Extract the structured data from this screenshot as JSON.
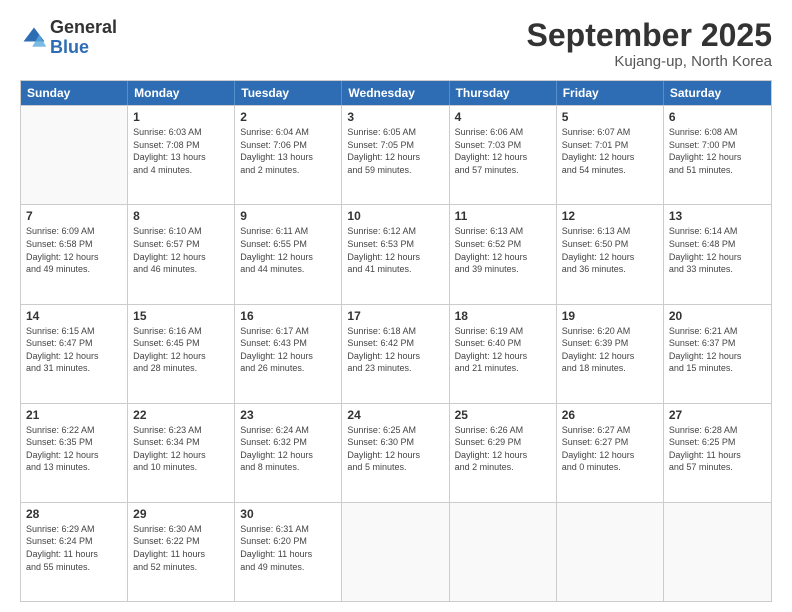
{
  "logo": {
    "general": "General",
    "blue": "Blue"
  },
  "title": "September 2025",
  "location": "Kujang-up, North Korea",
  "days_of_week": [
    "Sunday",
    "Monday",
    "Tuesday",
    "Wednesday",
    "Thursday",
    "Friday",
    "Saturday"
  ],
  "weeks": [
    [
      {
        "day": "",
        "sunrise": "",
        "sunset": "",
        "daylight": "",
        "empty": true
      },
      {
        "day": "1",
        "sunrise": "Sunrise: 6:03 AM",
        "sunset": "Sunset: 7:08 PM",
        "daylight": "Daylight: 13 hours and 4 minutes.",
        "empty": false
      },
      {
        "day": "2",
        "sunrise": "Sunrise: 6:04 AM",
        "sunset": "Sunset: 7:06 PM",
        "daylight": "Daylight: 13 hours and 2 minutes.",
        "empty": false
      },
      {
        "day": "3",
        "sunrise": "Sunrise: 6:05 AM",
        "sunset": "Sunset: 7:05 PM",
        "daylight": "Daylight: 12 hours and 59 minutes.",
        "empty": false
      },
      {
        "day": "4",
        "sunrise": "Sunrise: 6:06 AM",
        "sunset": "Sunset: 7:03 PM",
        "daylight": "Daylight: 12 hours and 57 minutes.",
        "empty": false
      },
      {
        "day": "5",
        "sunrise": "Sunrise: 6:07 AM",
        "sunset": "Sunset: 7:01 PM",
        "daylight": "Daylight: 12 hours and 54 minutes.",
        "empty": false
      },
      {
        "day": "6",
        "sunrise": "Sunrise: 6:08 AM",
        "sunset": "Sunset: 7:00 PM",
        "daylight": "Daylight: 12 hours and 51 minutes.",
        "empty": false
      }
    ],
    [
      {
        "day": "7",
        "sunrise": "Sunrise: 6:09 AM",
        "sunset": "Sunset: 6:58 PM",
        "daylight": "Daylight: 12 hours and 49 minutes.",
        "empty": false
      },
      {
        "day": "8",
        "sunrise": "Sunrise: 6:10 AM",
        "sunset": "Sunset: 6:57 PM",
        "daylight": "Daylight: 12 hours and 46 minutes.",
        "empty": false
      },
      {
        "day": "9",
        "sunrise": "Sunrise: 6:11 AM",
        "sunset": "Sunset: 6:55 PM",
        "daylight": "Daylight: 12 hours and 44 minutes.",
        "empty": false
      },
      {
        "day": "10",
        "sunrise": "Sunrise: 6:12 AM",
        "sunset": "Sunset: 6:53 PM",
        "daylight": "Daylight: 12 hours and 41 minutes.",
        "empty": false
      },
      {
        "day": "11",
        "sunrise": "Sunrise: 6:13 AM",
        "sunset": "Sunset: 6:52 PM",
        "daylight": "Daylight: 12 hours and 39 minutes.",
        "empty": false
      },
      {
        "day": "12",
        "sunrise": "Sunrise: 6:13 AM",
        "sunset": "Sunset: 6:50 PM",
        "daylight": "Daylight: 12 hours and 36 minutes.",
        "empty": false
      },
      {
        "day": "13",
        "sunrise": "Sunrise: 6:14 AM",
        "sunset": "Sunset: 6:48 PM",
        "daylight": "Daylight: 12 hours and 33 minutes.",
        "empty": false
      }
    ],
    [
      {
        "day": "14",
        "sunrise": "Sunrise: 6:15 AM",
        "sunset": "Sunset: 6:47 PM",
        "daylight": "Daylight: 12 hours and 31 minutes.",
        "empty": false
      },
      {
        "day": "15",
        "sunrise": "Sunrise: 6:16 AM",
        "sunset": "Sunset: 6:45 PM",
        "daylight": "Daylight: 12 hours and 28 minutes.",
        "empty": false
      },
      {
        "day": "16",
        "sunrise": "Sunrise: 6:17 AM",
        "sunset": "Sunset: 6:43 PM",
        "daylight": "Daylight: 12 hours and 26 minutes.",
        "empty": false
      },
      {
        "day": "17",
        "sunrise": "Sunrise: 6:18 AM",
        "sunset": "Sunset: 6:42 PM",
        "daylight": "Daylight: 12 hours and 23 minutes.",
        "empty": false
      },
      {
        "day": "18",
        "sunrise": "Sunrise: 6:19 AM",
        "sunset": "Sunset: 6:40 PM",
        "daylight": "Daylight: 12 hours and 21 minutes.",
        "empty": false
      },
      {
        "day": "19",
        "sunrise": "Sunrise: 6:20 AM",
        "sunset": "Sunset: 6:39 PM",
        "daylight": "Daylight: 12 hours and 18 minutes.",
        "empty": false
      },
      {
        "day": "20",
        "sunrise": "Sunrise: 6:21 AM",
        "sunset": "Sunset: 6:37 PM",
        "daylight": "Daylight: 12 hours and 15 minutes.",
        "empty": false
      }
    ],
    [
      {
        "day": "21",
        "sunrise": "Sunrise: 6:22 AM",
        "sunset": "Sunset: 6:35 PM",
        "daylight": "Daylight: 12 hours and 13 minutes.",
        "empty": false
      },
      {
        "day": "22",
        "sunrise": "Sunrise: 6:23 AM",
        "sunset": "Sunset: 6:34 PM",
        "daylight": "Daylight: 12 hours and 10 minutes.",
        "empty": false
      },
      {
        "day": "23",
        "sunrise": "Sunrise: 6:24 AM",
        "sunset": "Sunset: 6:32 PM",
        "daylight": "Daylight: 12 hours and 8 minutes.",
        "empty": false
      },
      {
        "day": "24",
        "sunrise": "Sunrise: 6:25 AM",
        "sunset": "Sunset: 6:30 PM",
        "daylight": "Daylight: 12 hours and 5 minutes.",
        "empty": false
      },
      {
        "day": "25",
        "sunrise": "Sunrise: 6:26 AM",
        "sunset": "Sunset: 6:29 PM",
        "daylight": "Daylight: 12 hours and 2 minutes.",
        "empty": false
      },
      {
        "day": "26",
        "sunrise": "Sunrise: 6:27 AM",
        "sunset": "Sunset: 6:27 PM",
        "daylight": "Daylight: 12 hours and 0 minutes.",
        "empty": false
      },
      {
        "day": "27",
        "sunrise": "Sunrise: 6:28 AM",
        "sunset": "Sunset: 6:25 PM",
        "daylight": "Daylight: 11 hours and 57 minutes.",
        "empty": false
      }
    ],
    [
      {
        "day": "28",
        "sunrise": "Sunrise: 6:29 AM",
        "sunset": "Sunset: 6:24 PM",
        "daylight": "Daylight: 11 hours and 55 minutes.",
        "empty": false
      },
      {
        "day": "29",
        "sunrise": "Sunrise: 6:30 AM",
        "sunset": "Sunset: 6:22 PM",
        "daylight": "Daylight: 11 hours and 52 minutes.",
        "empty": false
      },
      {
        "day": "30",
        "sunrise": "Sunrise: 6:31 AM",
        "sunset": "Sunset: 6:20 PM",
        "daylight": "Daylight: 11 hours and 49 minutes.",
        "empty": false
      },
      {
        "day": "",
        "sunrise": "",
        "sunset": "",
        "daylight": "",
        "empty": true
      },
      {
        "day": "",
        "sunrise": "",
        "sunset": "",
        "daylight": "",
        "empty": true
      },
      {
        "day": "",
        "sunrise": "",
        "sunset": "",
        "daylight": "",
        "empty": true
      },
      {
        "day": "",
        "sunrise": "",
        "sunset": "",
        "daylight": "",
        "empty": true
      }
    ]
  ]
}
